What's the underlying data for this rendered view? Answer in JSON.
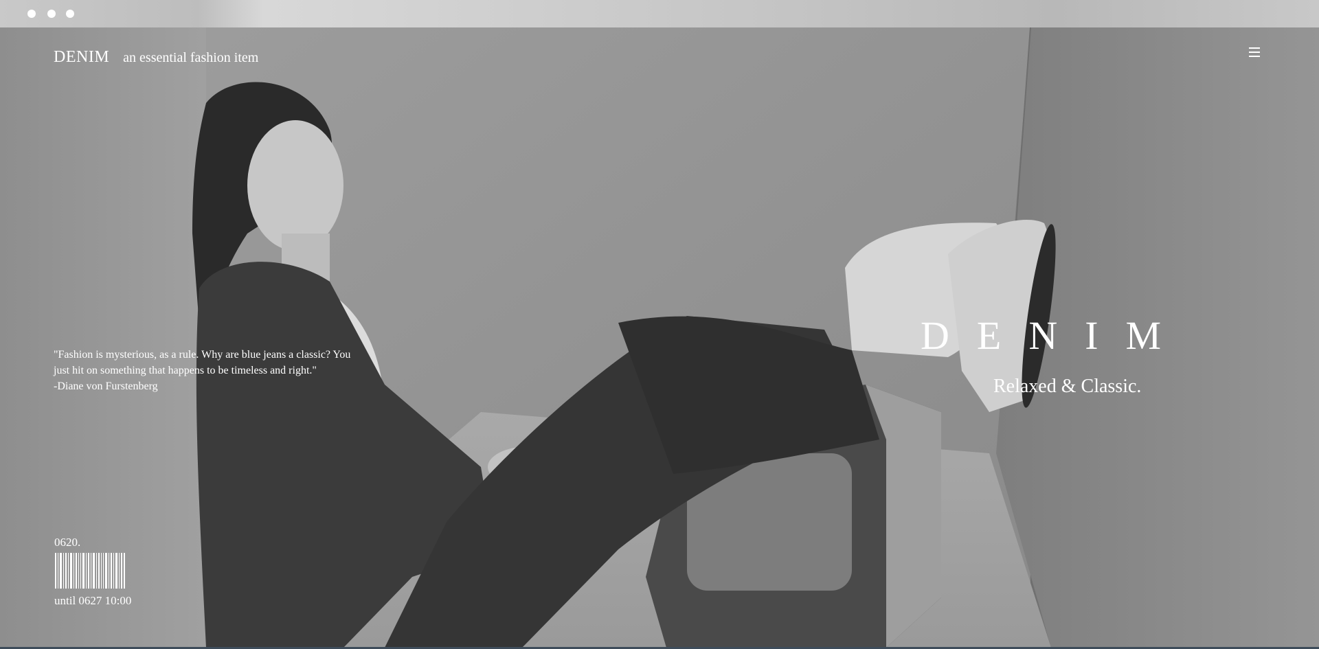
{
  "window": {
    "dots": [
      "window-dot-1",
      "window-dot-2",
      "window-dot-3"
    ]
  },
  "header": {
    "brand": "DENIM",
    "tagline": "an essential fashion item",
    "menu_icon": "menu-icon"
  },
  "quote": {
    "line1": "\"Fashion is mysterious, as a rule. Why are blue jeans a classic? You",
    "line2": "just hit on something that happens to be timeless and right.\"",
    "author": "-Diane von Furstenberg"
  },
  "hero": {
    "title": "DENIM",
    "subtitle": "Relaxed & Classic."
  },
  "ticket": {
    "code": "0620.",
    "until": "until 0627 10:00"
  },
  "colors": {
    "text": "#ffffff",
    "accent_line": "#3e4c5a"
  }
}
